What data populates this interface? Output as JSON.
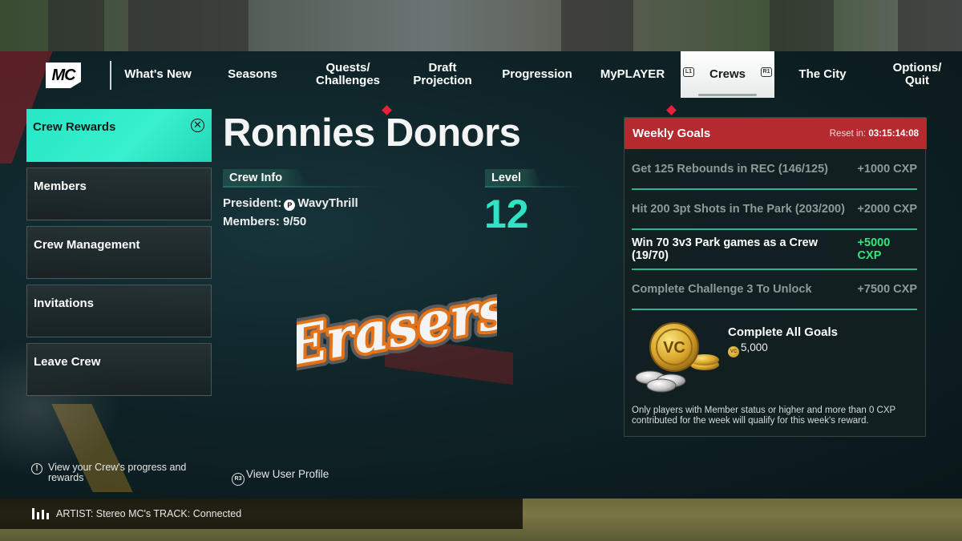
{
  "nav": {
    "logo": "MC",
    "tabs": [
      {
        "label": "What's New",
        "active": false,
        "badge": false
      },
      {
        "label": "Seasons",
        "active": false,
        "badge": false
      },
      {
        "label": "Quests/\nChallenges",
        "active": false,
        "badge": true
      },
      {
        "label": "Draft\nProjection",
        "active": false,
        "badge": false
      },
      {
        "label": "Progression",
        "active": false,
        "badge": false
      },
      {
        "label": "MyPLAYER",
        "active": false,
        "badge": true
      },
      {
        "label": "Crews",
        "active": true,
        "badge": false
      },
      {
        "label": "The City",
        "active": false,
        "badge": false
      },
      {
        "label": "Options/\nQuit",
        "active": false,
        "badge": false
      }
    ],
    "bumper_left": "L1",
    "bumper_right": "R1"
  },
  "sidebar": {
    "items": [
      {
        "label": "Crew Rewards",
        "active": true
      },
      {
        "label": "Members",
        "active": false
      },
      {
        "label": "Crew Management",
        "active": false
      },
      {
        "label": "Invitations",
        "active": false
      },
      {
        "label": "Leave Crew",
        "active": false
      }
    ],
    "close_glyph": "✕",
    "hint_icon": "!",
    "hint": "View your Crew's progress and rewards"
  },
  "crew": {
    "name": "Ronnies Donors",
    "info_header": "Crew Info",
    "president_label": "President:",
    "president": "WavyThrill",
    "members_label": "Members: 9/50",
    "level_header": "Level",
    "level": "12",
    "logo_text": "Erasers",
    "view_profile_button": "R3",
    "view_profile": "View User Profile"
  },
  "weekly_goals": {
    "title": "Weekly Goals",
    "reset_label": "Reset in:",
    "reset_time": "03:15:14:08",
    "goals": [
      {
        "text": "Get 125 Rebounds in REC (146/125)",
        "reward": "+1000 CXP",
        "state": "done"
      },
      {
        "text": "Hit 200 3pt Shots in The Park (203/200)",
        "reward": "+2000 CXP",
        "state": "done"
      },
      {
        "text": "Win 70 3v3 Park games as a Crew (19/70)",
        "reward": "+5000 CXP",
        "state": "current"
      },
      {
        "text": "Complete Challenge 3 To Unlock",
        "reward": "+7500 CXP",
        "state": "locked"
      }
    ],
    "complete_title": "Complete All Goals",
    "vc_icon": "VC",
    "vc_amount": "5,000",
    "note": "Only players with Member status or higher and more than 0 CXP contributed for the week will qualify for this week's reward."
  },
  "music": {
    "text": "ARTIST: Stereo MC's  TRACK: Connected"
  },
  "colors": {
    "accent": "#2fe3c4",
    "header_red": "#b52a2f",
    "active_green": "#2bea7b"
  }
}
